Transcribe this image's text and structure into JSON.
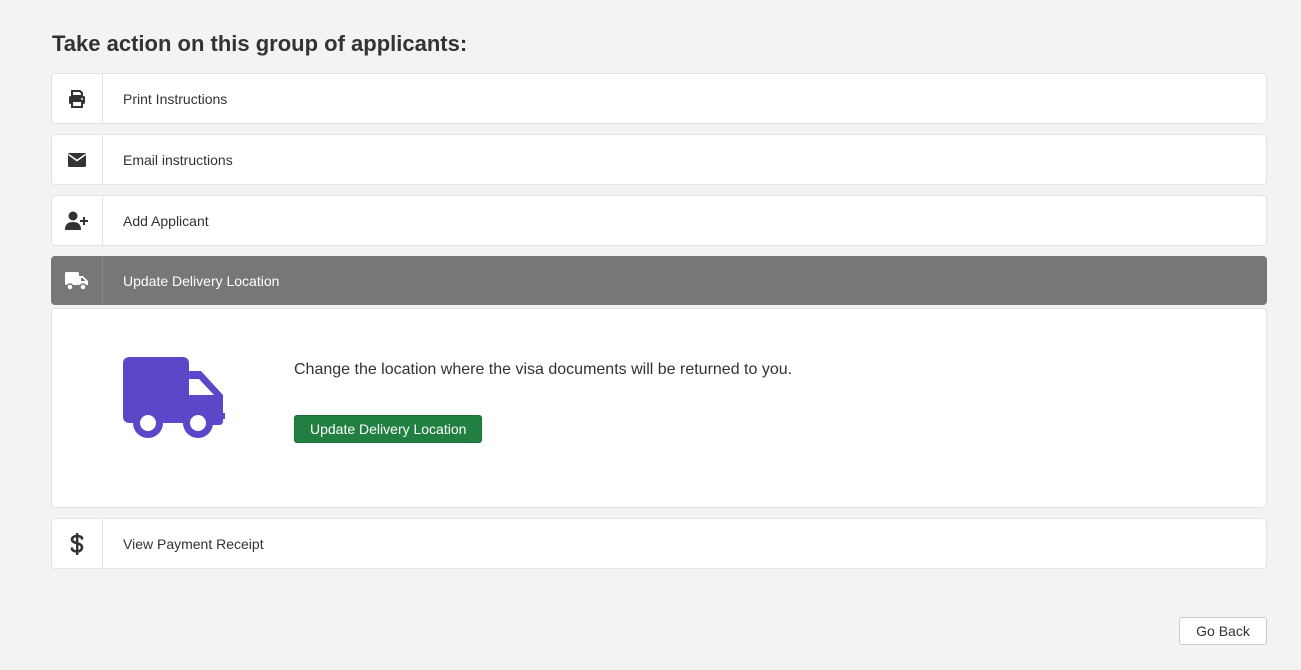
{
  "heading": "Take action on this group of applicants:",
  "actions": [
    {
      "label": "Print Instructions",
      "icon": "print-icon"
    },
    {
      "label": "Email instructions",
      "icon": "envelope-icon"
    },
    {
      "label": "Add Applicant",
      "icon": "user-plus-icon"
    },
    {
      "label": "Update Delivery Location",
      "icon": "truck-icon",
      "active": true
    },
    {
      "label": "View Payment Receipt",
      "icon": "dollar-icon"
    }
  ],
  "panel": {
    "description": "Change the location where the visa documents will be returned to you.",
    "button_label": "Update Delivery Location",
    "icon": "truck-icon"
  },
  "footer": {
    "back_label": "Go Back"
  },
  "colors": {
    "background": "#f3f3f3",
    "active_row": "#777777",
    "primary_button": "#218041",
    "truck_accent": "#5b48c9",
    "icon_dark": "#333333"
  }
}
